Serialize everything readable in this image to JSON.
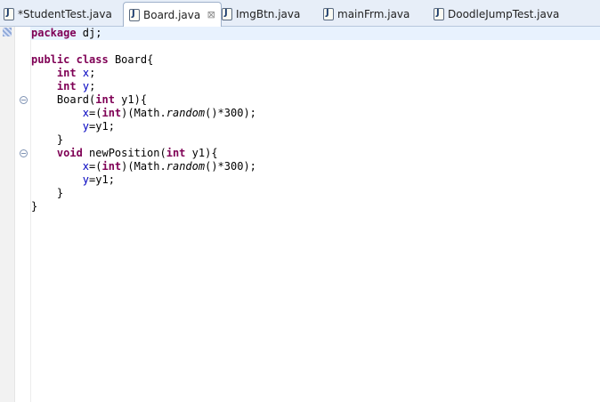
{
  "tabs": [
    {
      "label": "*StudentTest.java",
      "icon": "java-file-icon",
      "active": false
    },
    {
      "label": "Board.java",
      "icon": "java-file-icon",
      "active": true,
      "close": "⊠"
    },
    {
      "label": "ImgBtn.java",
      "icon": "java-file-icon",
      "active": false
    },
    {
      "label": "mainFrm.java",
      "icon": "java-file-icon",
      "active": false
    },
    {
      "label": "DoodleJumpTest.java",
      "icon": "java-file-icon",
      "active": false
    }
  ],
  "code": {
    "l1": {
      "kw": "package",
      "rest": " dj;"
    },
    "l3": {
      "kw1": "public",
      "kw2": "class",
      "rest": " Board{"
    },
    "l4": {
      "kw": "int",
      "fld": "x",
      "end": ";"
    },
    "l5": {
      "kw": "int",
      "fld": "y",
      "end": ";"
    },
    "l6": {
      "name": "Board(",
      "kw": "int",
      "rest": " y1){"
    },
    "l7": {
      "fld": "x",
      "a": "=(",
      "kw": "int",
      "b": ")(Math.",
      "it": "random",
      "c": "()*300);"
    },
    "l8": {
      "fld": "y",
      "a": "=y1;"
    },
    "l9": {
      "text": "}"
    },
    "l10": {
      "kw1": "void",
      "name": " newPosition(",
      "kw2": "int",
      "rest": " y1){"
    },
    "l11": {
      "fld": "x",
      "a": "=(",
      "kw": "int",
      "b": ")(Math.",
      "it": "random",
      "c": "()*300);"
    },
    "l12": {
      "fld": "y",
      "a": "=y1;"
    },
    "l13": {
      "text": "}"
    },
    "l14": {
      "text": "}"
    }
  },
  "colors": {
    "keyword": "#7f0055",
    "field": "#0000c0",
    "tab_bar": "#e7eef8",
    "current_line": "#e8f2fe"
  }
}
